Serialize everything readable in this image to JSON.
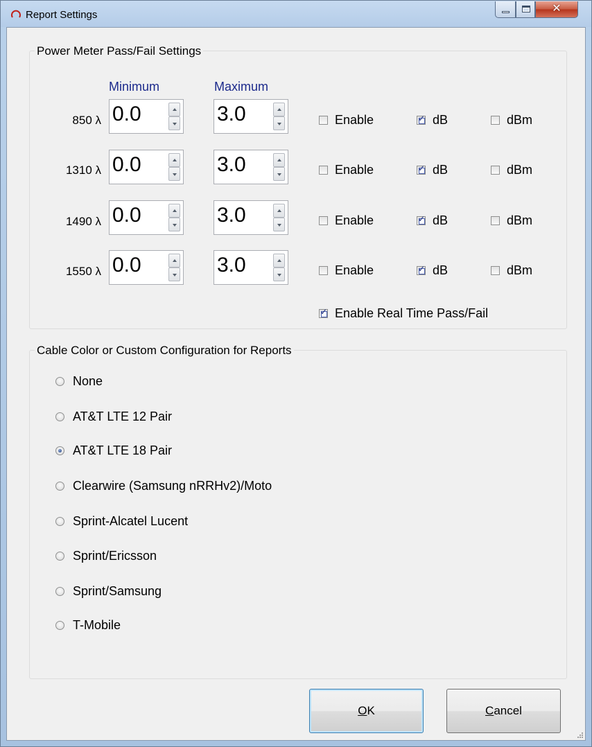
{
  "window": {
    "title": "Report Settings"
  },
  "power_meter": {
    "legend": "Power Meter Pass/Fail Settings",
    "min_header": "Minimum",
    "max_header": "Maximum",
    "rows": [
      {
        "label": "850 λ",
        "min": "0.0",
        "max": "3.0",
        "enable_label": "Enable",
        "enable": false,
        "db_label": "dB",
        "db": true,
        "dbm_label": "dBm",
        "dbm": false
      },
      {
        "label": "1310 λ",
        "min": "0.0",
        "max": "3.0",
        "enable_label": "Enable",
        "enable": false,
        "db_label": "dB",
        "db": true,
        "dbm_label": "dBm",
        "dbm": false
      },
      {
        "label": "1490 λ",
        "min": "0.0",
        "max": "3.0",
        "enable_label": "Enable",
        "enable": false,
        "db_label": "dB",
        "db": true,
        "dbm_label": "dBm",
        "dbm": false
      },
      {
        "label": "1550 λ",
        "min": "0.0",
        "max": "3.0",
        "enable_label": "Enable",
        "enable": false,
        "db_label": "dB",
        "db": true,
        "dbm_label": "dBm",
        "dbm": false
      }
    ],
    "realtime_label": "Enable Real Time Pass/Fail",
    "realtime": true
  },
  "cable": {
    "legend": "Cable Color or Custom Configuration for Reports",
    "options": [
      {
        "label": "None",
        "selected": false
      },
      {
        "label": "AT&T LTE 12 Pair",
        "selected": false
      },
      {
        "label": "AT&T LTE 18 Pair",
        "selected": true
      },
      {
        "label": "Clearwire (Samsung nRRHv2)/Moto",
        "selected": false
      },
      {
        "label": "Sprint-Alcatel Lucent",
        "selected": false
      },
      {
        "label": "Sprint/Ericsson",
        "selected": false
      },
      {
        "label": "Sprint/Samsung",
        "selected": false
      },
      {
        "label": "T-Mobile",
        "selected": false
      }
    ]
  },
  "buttons": {
    "ok_mnemonic": "O",
    "ok_rest": "K",
    "cancel_mnemonic": "C",
    "cancel_rest": "ancel"
  }
}
